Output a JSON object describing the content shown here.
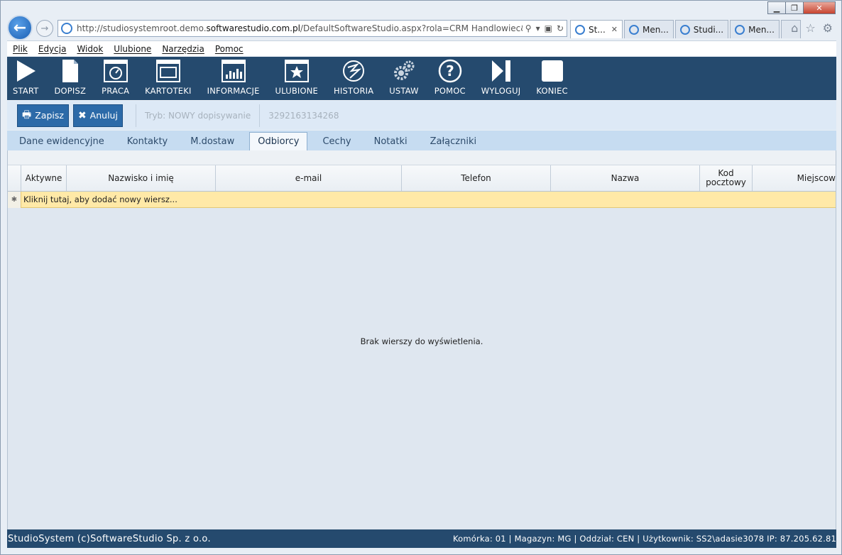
{
  "browser": {
    "url_prefix": "http://studiosystemroot.demo.",
    "url_domain": "softwarestudio.com.pl",
    "url_suffix": "/DefaultSoftwareStudio.aspx?rola=CRM Handlowiec&rolasys=CF",
    "tabs": [
      {
        "label": "St...",
        "active": true
      },
      {
        "label": "Men...",
        "active": false
      },
      {
        "label": "Studi...",
        "active": false
      },
      {
        "label": "Men...",
        "active": false
      }
    ],
    "menu": [
      "Plik",
      "Edycja",
      "Widok",
      "Ulubione",
      "Narzędzia",
      "Pomoc"
    ]
  },
  "toolbar": {
    "items": [
      {
        "label": "START",
        "icon": "play-icon"
      },
      {
        "label": "DOPISZ",
        "icon": "new-document-icon"
      },
      {
        "label": "PRACA",
        "icon": "gauge-window-icon"
      },
      {
        "label": "KARTOTEKI",
        "icon": "window-list-icon"
      },
      {
        "label": "INFORMACJE",
        "icon": "bar-chart-icon"
      },
      {
        "label": "ULUBIONE",
        "icon": "star-window-icon"
      },
      {
        "label": "HISTORIA",
        "icon": "history-globe-icon"
      },
      {
        "label": "USTAW",
        "icon": "gears-icon"
      },
      {
        "label": "POMOC",
        "icon": "help-icon"
      },
      {
        "label": "WYLOGUJ",
        "icon": "logout-icon"
      },
      {
        "label": "KONIEC",
        "icon": "stop-square-icon"
      }
    ]
  },
  "actions": {
    "save_label": "Zapisz",
    "cancel_label": "Anuluj",
    "mode_text": "Tryb: NOWY dopisywanie",
    "record_id": "3292163134268"
  },
  "form_tabs": [
    {
      "label": "Dane ewidencyjne",
      "active": false
    },
    {
      "label": "Kontakty",
      "active": false
    },
    {
      "label": "M.dostaw",
      "active": false
    },
    {
      "label": "Odbiorcy",
      "active": true
    },
    {
      "label": "Cechy",
      "active": false
    },
    {
      "label": "Notatki",
      "active": false
    },
    {
      "label": "Załączniki",
      "active": false
    }
  ],
  "grid": {
    "columns": [
      "Aktywne",
      "Nazwisko i imię",
      "e-mail",
      "Telefon",
      "Nazwa",
      "Kod pocztowy",
      "Miejscow"
    ],
    "new_row_text": "Kliknij tutaj, aby dodać nowy wiersz...",
    "empty_text": "Brak wierszy do wyświetlenia."
  },
  "status": {
    "left": "StudioSystem (c)SoftwareStudio Sp. z o.o.",
    "right": "Komórka: 01 | Magazyn: MG | Oddział: CEN | Użytkownik: SS2\\adasie3078 IP: 87.205.62.81"
  }
}
